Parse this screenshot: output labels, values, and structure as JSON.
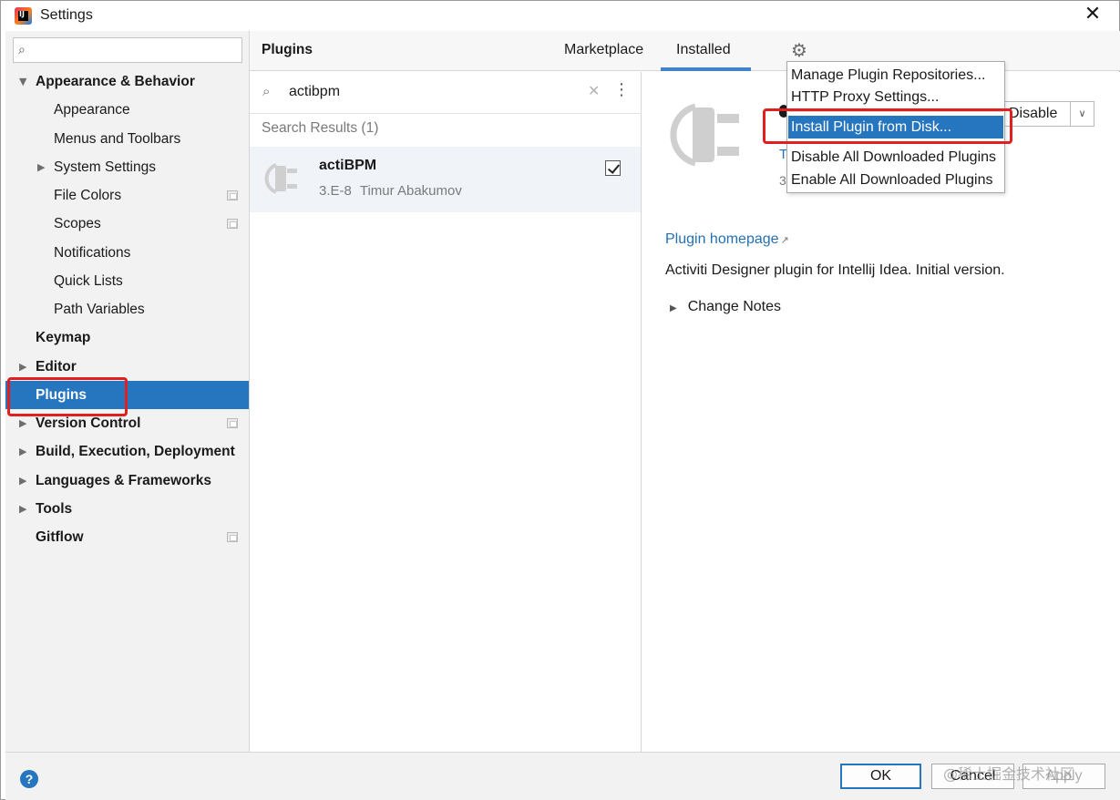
{
  "window": {
    "title": "Settings",
    "close_glyph": "✕"
  },
  "sidebar": {
    "search_placeholder": "",
    "items": [
      {
        "label": "Appearance & Behavior",
        "bold": true,
        "arrow": "down"
      },
      {
        "label": "Appearance"
      },
      {
        "label": "Menus and Toolbars"
      },
      {
        "label": "System Settings",
        "arrow": "right"
      },
      {
        "label": "File Colors",
        "project_icon": true
      },
      {
        "label": "Scopes",
        "project_icon": true
      },
      {
        "label": "Notifications"
      },
      {
        "label": "Quick Lists"
      },
      {
        "label": "Path Variables"
      },
      {
        "label": "Keymap",
        "bold": true
      },
      {
        "label": "Editor",
        "bold": true,
        "arrow": "right"
      },
      {
        "label": "Plugins",
        "bold": true,
        "selected": true
      },
      {
        "label": "Version Control",
        "bold": true,
        "arrow": "right",
        "project_icon": true
      },
      {
        "label": "Build, Execution, Deployment",
        "bold": true,
        "arrow": "right"
      },
      {
        "label": "Languages & Frameworks",
        "bold": true,
        "arrow": "right"
      },
      {
        "label": "Tools",
        "bold": true,
        "arrow": "right"
      },
      {
        "label": "Gitflow",
        "bold": true,
        "project_icon": true
      }
    ]
  },
  "plugins_header": {
    "title": "Plugins",
    "tabs": [
      {
        "label": "Marketplace",
        "active": false
      },
      {
        "label": "Installed",
        "active": true
      }
    ],
    "gear_icon": "gear-icon"
  },
  "plugin_list": {
    "search_value": "actibpm",
    "results_label": "Search Results (1)",
    "results": [
      {
        "name": "actiBPM",
        "version": "3.E-8",
        "author": "Timur Abakumov",
        "enabled": true
      }
    ]
  },
  "detail": {
    "disable_label": "Disable",
    "peek_link": "T",
    "peek_version": "3",
    "homepage_label": "Plugin homepage",
    "external_glyph": "↗",
    "description": "Activiti Designer plugin for Intellij Idea. Initial version.",
    "change_notes_label": "Change Notes"
  },
  "gear_menu": {
    "items": [
      {
        "label": "Manage Plugin Repositories..."
      },
      {
        "label": "HTTP Proxy Settings..."
      },
      {
        "label": "Install Plugin from Disk...",
        "highlighted": true
      },
      {
        "label": "Disable All Downloaded Plugins"
      },
      {
        "label": "Enable All Downloaded Plugins"
      }
    ]
  },
  "footer": {
    "help_glyph": "?",
    "ok_label": "OK",
    "cancel_label": "Cancel",
    "apply_label": "Apply",
    "watermark": "@稀土掘金技术社区"
  },
  "colors": {
    "selection": "#2675bf",
    "link": "#2470b3",
    "annotation": "#e02020"
  }
}
